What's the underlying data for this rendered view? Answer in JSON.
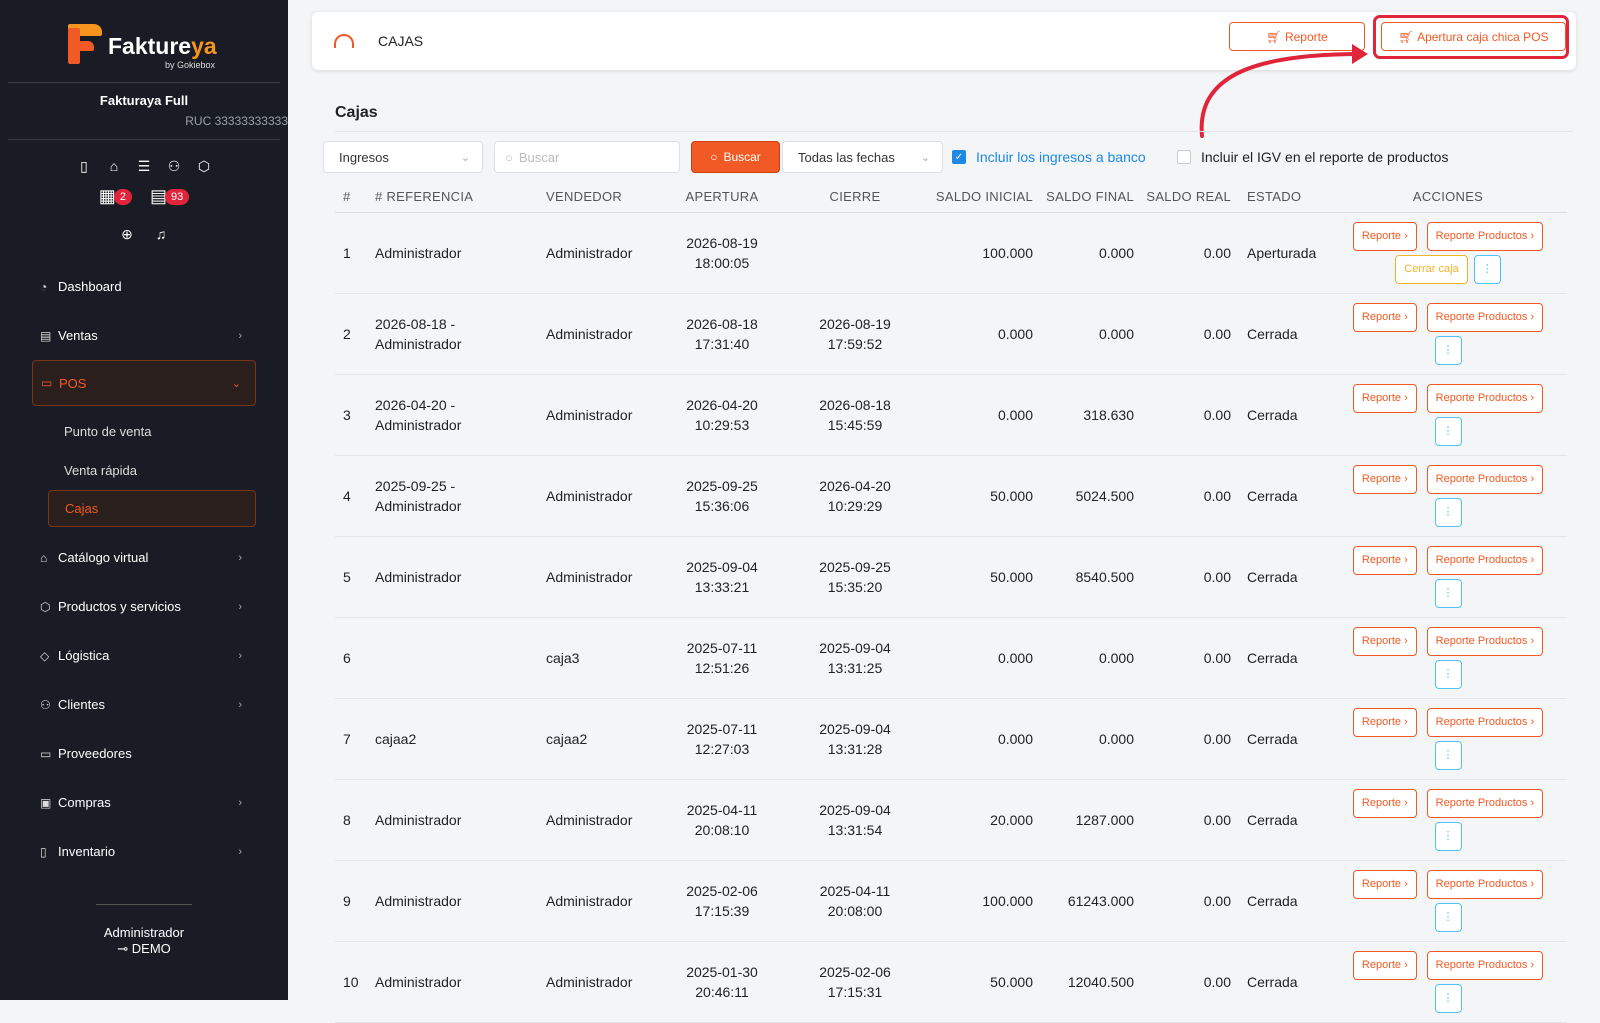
{
  "brand": {
    "name_a": "Fakture",
    "name_b": "ya",
    "sub": "by Gokiebox"
  },
  "company": {
    "name": "Fakturaya Full",
    "ruc": "RUC 33333333333"
  },
  "quick_icons": [
    "document-icon",
    "store-icon",
    "list-icon",
    "users-icon",
    "box-icon"
  ],
  "badges": {
    "calendar": "2",
    "boxes": "93"
  },
  "nav": {
    "dashboard": "Dashboard",
    "ventas": "Ventas",
    "pos": "POS",
    "pos_sub": [
      "Punto de venta",
      "Venta rápida",
      "Cajas"
    ],
    "catalogo": "Catálogo virtual",
    "productos": "Productos y servicios",
    "logistica": "Lógistica",
    "clientes": "Clientes",
    "proveedores": "Proveedores",
    "compras": "Compras",
    "inventario": "Inventario"
  },
  "user": {
    "name": "Administrador",
    "role": "DEMO"
  },
  "topbar": {
    "title": "CAJAS",
    "btn_report": "Reporte",
    "btn_open": "Apertura caja chica POS"
  },
  "panel": {
    "title": "Cajas"
  },
  "filters": {
    "type": "Ingresos",
    "search_placeholder": "Buscar",
    "search_btn": "Buscar",
    "dates": "Todas las fechas",
    "chk_bank": "Incluir los ingresos a banco",
    "chk_igv": "Incluir el IGV en el reporte de productos"
  },
  "colors": {
    "accent": "#f15a24",
    "sidebar": "#191c24",
    "highlight": "#e0243a"
  },
  "table": {
    "headers": [
      "#",
      "# REFERENCIA",
      "VENDEDOR",
      "APERTURA",
      "CIERRE",
      "SALDO INICIAL",
      "SALDO FINAL",
      "SALDO REAL",
      "ESTADO",
      "ACCIONES"
    ],
    "actions": {
      "report": "Reporte",
      "report_products": "Reporte Productos",
      "close": "Cerrar caja"
    },
    "rows": [
      {
        "n": "1",
        "ref": "Administrador",
        "seller": "Administrador",
        "open_d": "2026-08-19",
        "open_t": "18:00:05",
        "close_d": "",
        "close_t": "",
        "ini": "100.000",
        "fin": "0.000",
        "real": "0.00",
        "state": "Aperturada"
      },
      {
        "n": "2",
        "ref": "2026-08-18 -",
        "ref2": "Administrador",
        "seller": "Administrador",
        "open_d": "2026-08-18",
        "open_t": "17:31:40",
        "close_d": "2026-08-19",
        "close_t": "17:59:52",
        "ini": "0.000",
        "fin": "0.000",
        "real": "0.00",
        "state": "Cerrada"
      },
      {
        "n": "3",
        "ref": "2026-04-20 -",
        "ref2": "Administrador",
        "seller": "Administrador",
        "open_d": "2026-04-20",
        "open_t": "10:29:53",
        "close_d": "2026-08-18",
        "close_t": "15:45:59",
        "ini": "0.000",
        "fin": "318.630",
        "real": "0.00",
        "state": "Cerrada"
      },
      {
        "n": "4",
        "ref": "2025-09-25 -",
        "ref2": "Administrador",
        "seller": "Administrador",
        "open_d": "2025-09-25",
        "open_t": "15:36:06",
        "close_d": "2026-04-20",
        "close_t": "10:29:29",
        "ini": "50.000",
        "fin": "5024.500",
        "real": "0.00",
        "state": "Cerrada"
      },
      {
        "n": "5",
        "ref": "Administrador",
        "seller": "Administrador",
        "open_d": "2025-09-04",
        "open_t": "13:33:21",
        "close_d": "2025-09-25",
        "close_t": "15:35:20",
        "ini": "50.000",
        "fin": "8540.500",
        "real": "0.00",
        "state": "Cerrada"
      },
      {
        "n": "6",
        "ref": "",
        "seller": "caja3",
        "open_d": "2025-07-11",
        "open_t": "12:51:26",
        "close_d": "2025-09-04",
        "close_t": "13:31:25",
        "ini": "0.000",
        "fin": "0.000",
        "real": "0.00",
        "state": "Cerrada"
      },
      {
        "n": "7",
        "ref": "cajaa2",
        "seller": "cajaa2",
        "open_d": "2025-07-11",
        "open_t": "12:27:03",
        "close_d": "2025-09-04",
        "close_t": "13:31:28",
        "ini": "0.000",
        "fin": "0.000",
        "real": "0.00",
        "state": "Cerrada"
      },
      {
        "n": "8",
        "ref": "Administrador",
        "seller": "Administrador",
        "open_d": "2025-04-11",
        "open_t": "20:08:10",
        "close_d": "2025-09-04",
        "close_t": "13:31:54",
        "ini": "20.000",
        "fin": "1287.000",
        "real": "0.00",
        "state": "Cerrada"
      },
      {
        "n": "9",
        "ref": "Administrador",
        "seller": "Administrador",
        "open_d": "2025-02-06",
        "open_t": "17:15:39",
        "close_d": "2025-04-11",
        "close_t": "20:08:00",
        "ini": "100.000",
        "fin": "61243.000",
        "real": "0.00",
        "state": "Cerrada"
      },
      {
        "n": "10",
        "ref": "Administrador",
        "seller": "Administrador",
        "open_d": "2025-01-30",
        "open_t": "20:46:11",
        "close_d": "2025-02-06",
        "close_t": "17:15:31",
        "ini": "50.000",
        "fin": "12040.500",
        "real": "0.00",
        "state": "Cerrada"
      }
    ]
  }
}
